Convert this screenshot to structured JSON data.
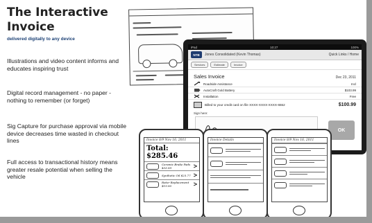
{
  "slide": {
    "title": "The Interactive Invoice",
    "subtitle": "delivered digitally to any device",
    "bullets": [
      "Illustrations and video content informs and educates inspiring trust",
      "Digital record management - no paper - nothing to remember (or forget)",
      "Sig Capture for purchase approval via mobile device decreases time wasted in checkout lines",
      "Full access to transactional history means greater resale potential when selling the vehicle"
    ]
  },
  "tablet": {
    "status_left": "iPad",
    "status_center": "10:27",
    "status_right": "100%",
    "logo": "NTB",
    "customer": "Jones Consolidated (Kevin Thomas)",
    "menu": "Quick Links / Home",
    "tabs": [
      "Services",
      "Estimate",
      "Invoice"
    ],
    "invoice_title": "Sales Invoice",
    "invoice_date": "Dec 23, 2011",
    "items": [
      {
        "icon": "wrench-icon",
        "name": "Roadside Assistance",
        "price": "Incl"
      },
      {
        "icon": "battery-icon",
        "name": "AutoCraft Gold Battery",
        "price": "$103.99"
      },
      {
        "icon": "tools-icon",
        "name": "Installation",
        "price": "Free"
      }
    ],
    "billed_to": "Billed to your credit card on file XXXX-XXXX-XXXX-6552",
    "total": "$100.99",
    "sign_label": "Sign here:",
    "ok_label": "OK"
  },
  "phones": {
    "left": {
      "header": "Invoice   8/9   Nov 16, 2011",
      "total": "Total: $285.46",
      "rows": [
        "Ceramic Brake Pads $33.99",
        "Synthetic Oil $25.77",
        "Rotor Replacement $19.90"
      ]
    },
    "middle": {
      "header": "Invoice   Details"
    },
    "right": {
      "header": "Invoice   8/9   Nov 16, 2011"
    }
  }
}
